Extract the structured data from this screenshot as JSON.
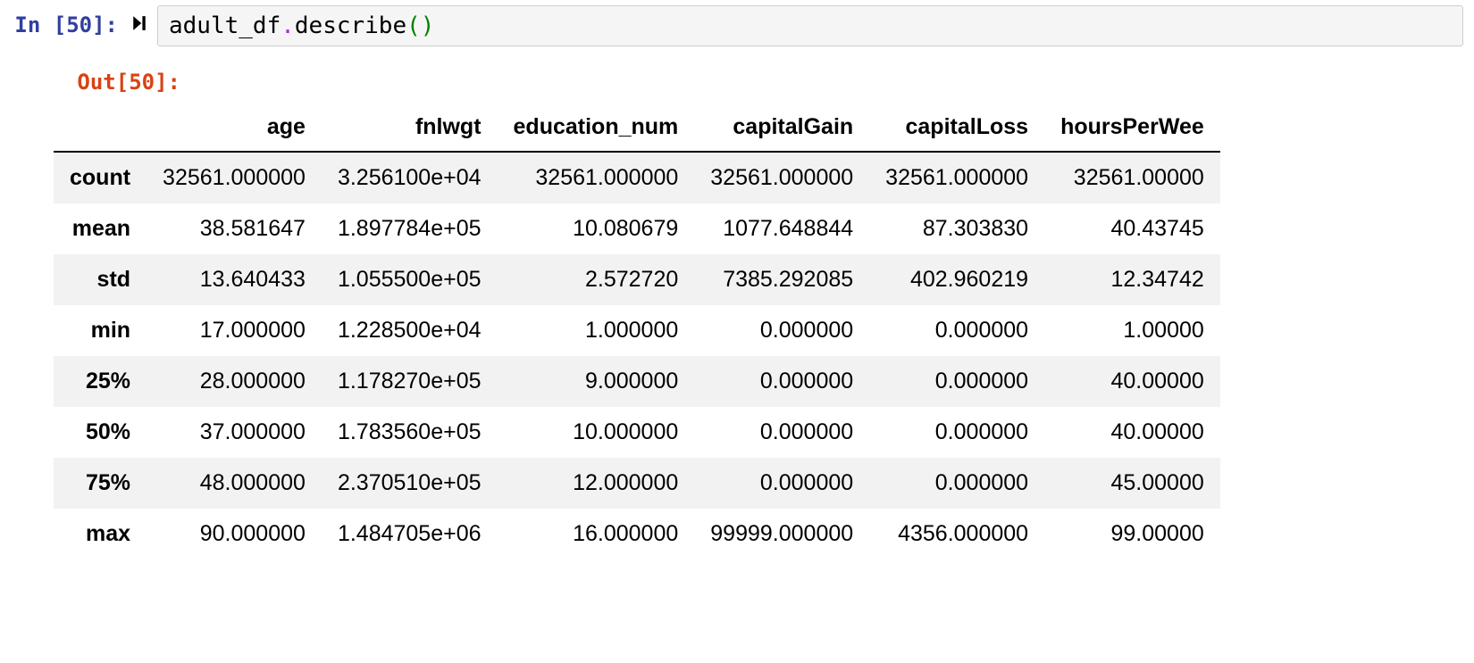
{
  "input": {
    "prompt_label": "In [50]:",
    "code_ident": "adult_df",
    "code_dot": ".",
    "code_method": "describe",
    "code_parens": "()"
  },
  "output": {
    "prompt_label": "Out[50]:",
    "table": {
      "columns": [
        "age",
        "fnlwgt",
        "education_num",
        "capitalGain",
        "capitalLoss",
        "hoursPerWee"
      ],
      "rows": [
        {
          "label": "count",
          "values": [
            "32561.000000",
            "3.256100e+04",
            "32561.000000",
            "32561.000000",
            "32561.000000",
            "32561.00000"
          ]
        },
        {
          "label": "mean",
          "values": [
            "38.581647",
            "1.897784e+05",
            "10.080679",
            "1077.648844",
            "87.303830",
            "40.43745"
          ]
        },
        {
          "label": "std",
          "values": [
            "13.640433",
            "1.055500e+05",
            "2.572720",
            "7385.292085",
            "402.960219",
            "12.34742"
          ]
        },
        {
          "label": "min",
          "values": [
            "17.000000",
            "1.228500e+04",
            "1.000000",
            "0.000000",
            "0.000000",
            "1.00000"
          ]
        },
        {
          "label": "25%",
          "values": [
            "28.000000",
            "1.178270e+05",
            "9.000000",
            "0.000000",
            "0.000000",
            "40.00000"
          ]
        },
        {
          "label": "50%",
          "values": [
            "37.000000",
            "1.783560e+05",
            "10.000000",
            "0.000000",
            "0.000000",
            "40.00000"
          ]
        },
        {
          "label": "75%",
          "values": [
            "48.000000",
            "2.370510e+05",
            "12.000000",
            "0.000000",
            "0.000000",
            "45.00000"
          ]
        },
        {
          "label": "max",
          "values": [
            "90.000000",
            "1.484705e+06",
            "16.000000",
            "99999.000000",
            "4356.000000",
            "99.00000"
          ]
        }
      ]
    }
  }
}
